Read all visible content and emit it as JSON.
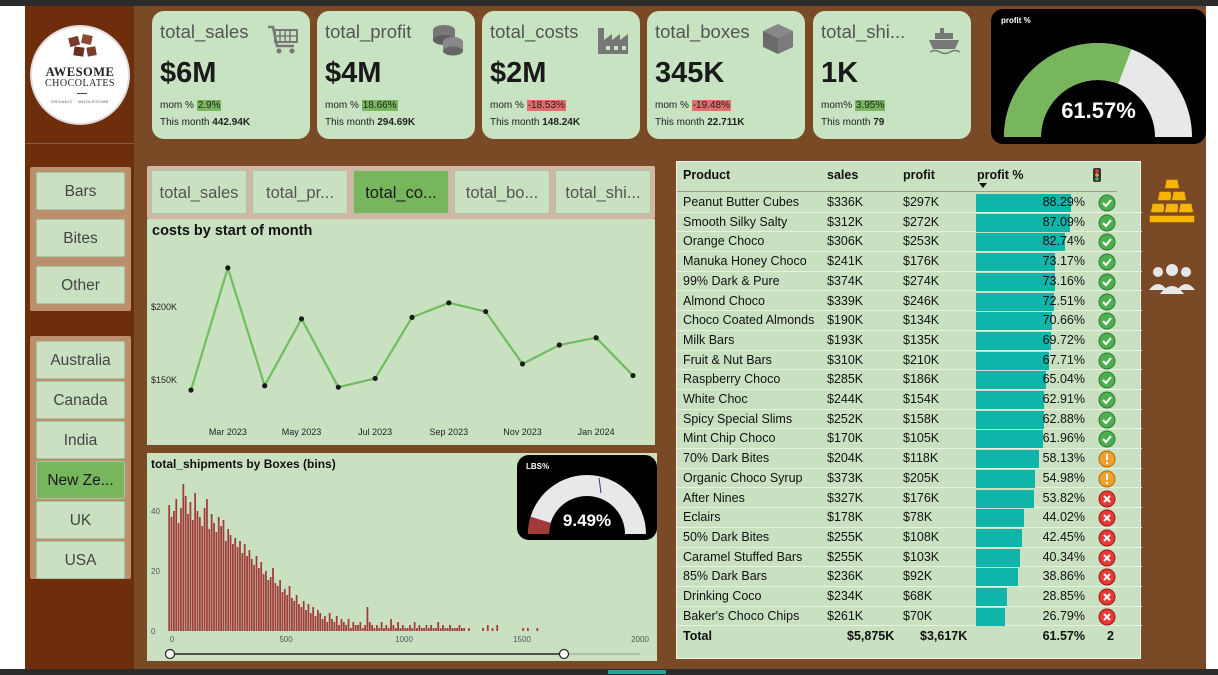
{
  "brand": {
    "line1": "AWESOME",
    "line2": "CHOCOLATES",
    "tagline": "ORGANIC · WHOLESOME"
  },
  "category_slicer": [
    "Bars",
    "Bites",
    "Other"
  ],
  "country_slicer": {
    "items": [
      "Australia",
      "Canada",
      "India",
      "New Ze...",
      "UK",
      "USA"
    ],
    "selected": "New Ze..."
  },
  "kpis": [
    {
      "title": "total_sales",
      "value": "$6M",
      "mom_label": "mom %",
      "mom_value": "2.9%",
      "mom_dir": "pos",
      "month_label": "This month",
      "month_value": "442.94K",
      "icon": "shopping-cart-icon"
    },
    {
      "title": "total_profit",
      "value": "$4M",
      "mom_label": "mom %",
      "mom_value": "18.66%",
      "mom_dir": "pos",
      "month_label": "This month",
      "month_value": "294.69K",
      "icon": "coins-icon"
    },
    {
      "title": "total_costs",
      "value": "$2M",
      "mom_label": "mom %",
      "mom_value": "-18.53%",
      "mom_dir": "neg",
      "month_label": "This month",
      "month_value": "148.24K",
      "icon": "factory-icon"
    },
    {
      "title": "total_boxes",
      "value": "345K",
      "mom_label": "mom %",
      "mom_value": "-19.48%",
      "mom_dir": "neg",
      "month_label": "This month",
      "month_value": "22.711K",
      "icon": "box-icon"
    },
    {
      "title": "total_shi...",
      "value": "1K",
      "mom_label": "mom%",
      "mom_value": "3.95%",
      "mom_dir": "pos",
      "month_label": "This month",
      "month_value": "79",
      "icon": "ship-icon"
    }
  ],
  "profit_gauge": {
    "label": "profit %",
    "value_text": "61.57%",
    "value": 61.57,
    "colors": {
      "fill": "#78b65e",
      "rest": "#e8e8e8"
    }
  },
  "metric_tabs": {
    "items": [
      "total_sales",
      "total_pr...",
      "total_co...",
      "total_bo...",
      "total_shi..."
    ],
    "selected": "total_co..."
  },
  "chart_data": [
    {
      "type": "line",
      "title": "costs by start of month",
      "x": [
        "Feb 2023",
        "Mar 2023",
        "Apr 2023",
        "May 2023",
        "Jun 2023",
        "Jul 2023",
        "Aug 2023",
        "Sep 2023",
        "Oct 2023",
        "Nov 2023",
        "Dec 2023",
        "Jan 2024",
        "Feb 2024"
      ],
      "x_tick_labels": [
        "Mar 2023",
        "May 2023",
        "Jul 2023",
        "Sep 2023",
        "Nov 2023",
        "Jan 2024"
      ],
      "y": [
        143,
        227,
        146,
        192,
        145,
        151,
        193,
        203,
        197,
        161,
        174,
        179,
        153
      ],
      "y_tick_labels": [
        "$200K",
        "$150K"
      ],
      "ylabel": "",
      "xlabel": "",
      "ylim": [
        130,
        240
      ],
      "y_unit": "$K",
      "color": "#6fbd5e",
      "grid": false
    },
    {
      "type": "bar",
      "title": "total_shipments by Boxes (bins)",
      "x_tick_labels": [
        "0",
        "500",
        "1000",
        "1500",
        "2000"
      ],
      "y_tick_labels": [
        "0",
        "20",
        "40"
      ],
      "xlim": [
        0,
        2000
      ],
      "ylim": [
        0,
        50
      ],
      "bin_width": 10,
      "bin_starts": [
        0,
        10,
        20,
        30,
        40,
        50,
        60,
        70,
        80,
        90,
        100,
        110,
        120,
        130,
        140,
        150,
        160,
        170,
        180,
        190,
        200,
        210,
        220,
        230,
        240,
        250,
        260,
        270,
        280,
        290,
        300,
        310,
        320,
        330,
        340,
        350,
        360,
        370,
        380,
        390,
        400,
        410,
        420,
        430,
        440,
        450,
        460,
        470,
        480,
        490,
        500,
        510,
        520,
        530,
        540,
        550,
        560,
        570,
        580,
        590,
        600,
        610,
        620,
        630,
        640,
        650,
        660,
        670,
        680,
        690,
        700,
        710,
        720,
        730,
        740,
        750,
        760,
        770,
        780,
        790,
        800,
        810,
        820,
        830,
        840,
        850,
        860,
        870,
        880,
        890,
        900,
        910,
        920,
        930,
        940,
        950,
        960,
        970,
        980,
        990,
        1000,
        1010,
        1020,
        1030,
        1040,
        1050,
        1060,
        1070,
        1080,
        1090,
        1100,
        1110,
        1120,
        1130,
        1140,
        1150,
        1160,
        1170,
        1180,
        1190,
        1200,
        1210,
        1220,
        1230,
        1240,
        1250,
        1270,
        1330,
        1350,
        1370,
        1390,
        1500,
        1520,
        1560
      ],
      "values": [
        42,
        38,
        40,
        44,
        36,
        41,
        49,
        45,
        39,
        43,
        37,
        46,
        40,
        38,
        35,
        41,
        44,
        34,
        39,
        36,
        33,
        38,
        35,
        37,
        30,
        34,
        32,
        29,
        31,
        28,
        30,
        26,
        29,
        25,
        27,
        24,
        22,
        25,
        21,
        23,
        19,
        20,
        17,
        18,
        21,
        16,
        15,
        17,
        13,
        14,
        12,
        15,
        11,
        10,
        12,
        9,
        8,
        10,
        7,
        9,
        6,
        8,
        5,
        7,
        6,
        4,
        5,
        3,
        6,
        4,
        3,
        5,
        2,
        4,
        3,
        2,
        4,
        1,
        3,
        2,
        2,
        3,
        1,
        2,
        8,
        3,
        2,
        1,
        2,
        1,
        3,
        1,
        2,
        1,
        4,
        2,
        1,
        3,
        1,
        2,
        1,
        1,
        2,
        1,
        3,
        1,
        2,
        1,
        1,
        2,
        1,
        2,
        1,
        1,
        3,
        1,
        2,
        1,
        1,
        2,
        1,
        1,
        1,
        2,
        1,
        1,
        1,
        1,
        2,
        1,
        2,
        1,
        1,
        1
      ],
      "color": "#a23a3a"
    }
  ],
  "lbs_gauge": {
    "label": "LBS%",
    "value_text": "9.49%",
    "value": 9.49,
    "colors": {
      "fill": "#a23a3a",
      "rest": "#e8e8e8"
    }
  },
  "product_table": {
    "headers": {
      "product": "Product",
      "sales": "sales",
      "profit": "profit",
      "profit_pct": "profit %"
    },
    "rows": [
      {
        "product": "Peanut Butter Cubes",
        "sales": "$336K",
        "profit": "$297K",
        "profit_pct": "88.29%",
        "pct": 88.29,
        "status": "ok"
      },
      {
        "product": "Smooth Silky Salty",
        "sales": "$312K",
        "profit": "$272K",
        "profit_pct": "87.09%",
        "pct": 87.09,
        "status": "ok"
      },
      {
        "product": "Orange Choco",
        "sales": "$306K",
        "profit": "$253K",
        "profit_pct": "82.74%",
        "pct": 82.74,
        "status": "ok"
      },
      {
        "product": "Manuka Honey Choco",
        "sales": "$241K",
        "profit": "$176K",
        "profit_pct": "73.17%",
        "pct": 73.17,
        "status": "ok"
      },
      {
        "product": "99% Dark & Pure",
        "sales": "$374K",
        "profit": "$274K",
        "profit_pct": "73.16%",
        "pct": 73.16,
        "status": "ok"
      },
      {
        "product": "Almond Choco",
        "sales": "$339K",
        "profit": "$246K",
        "profit_pct": "72.51%",
        "pct": 72.51,
        "status": "ok"
      },
      {
        "product": "Choco Coated Almonds",
        "sales": "$190K",
        "profit": "$134K",
        "profit_pct": "70.66%",
        "pct": 70.66,
        "status": "ok"
      },
      {
        "product": "Milk Bars",
        "sales": "$193K",
        "profit": "$135K",
        "profit_pct": "69.72%",
        "pct": 69.72,
        "status": "ok"
      },
      {
        "product": "Fruit & Nut Bars",
        "sales": "$310K",
        "profit": "$210K",
        "profit_pct": "67.71%",
        "pct": 67.71,
        "status": "ok"
      },
      {
        "product": "Raspberry Choco",
        "sales": "$285K",
        "profit": "$186K",
        "profit_pct": "65.04%",
        "pct": 65.04,
        "status": "ok"
      },
      {
        "product": "White Choc",
        "sales": "$244K",
        "profit": "$154K",
        "profit_pct": "62.91%",
        "pct": 62.91,
        "status": "ok"
      },
      {
        "product": "Spicy Special Slims",
        "sales": "$252K",
        "profit": "$158K",
        "profit_pct": "62.88%",
        "pct": 62.88,
        "status": "ok"
      },
      {
        "product": "Mint Chip Choco",
        "sales": "$170K",
        "profit": "$105K",
        "profit_pct": "61.96%",
        "pct": 61.96,
        "status": "ok"
      },
      {
        "product": "70% Dark Bites",
        "sales": "$204K",
        "profit": "$118K",
        "profit_pct": "58.13%",
        "pct": 58.13,
        "status": "warn"
      },
      {
        "product": "Organic Choco Syrup",
        "sales": "$373K",
        "profit": "$205K",
        "profit_pct": "54.98%",
        "pct": 54.98,
        "status": "warn"
      },
      {
        "product": "After Nines",
        "sales": "$327K",
        "profit": "$176K",
        "profit_pct": "53.82%",
        "pct": 53.82,
        "status": "bad"
      },
      {
        "product": "Eclairs",
        "sales": "$178K",
        "profit": "$78K",
        "profit_pct": "44.02%",
        "pct": 44.02,
        "status": "bad"
      },
      {
        "product": "50% Dark Bites",
        "sales": "$255K",
        "profit": "$108K",
        "profit_pct": "42.45%",
        "pct": 42.45,
        "status": "bad"
      },
      {
        "product": "Caramel Stuffed Bars",
        "sales": "$255K",
        "profit": "$103K",
        "profit_pct": "40.34%",
        "pct": 40.34,
        "status": "bad"
      },
      {
        "product": "85% Dark Bars",
        "sales": "$236K",
        "profit": "$92K",
        "profit_pct": "38.86%",
        "pct": 38.86,
        "status": "bad"
      },
      {
        "product": "Drinking Coco",
        "sales": "$234K",
        "profit": "$68K",
        "profit_pct": "28.85%",
        "pct": 28.85,
        "status": "bad"
      },
      {
        "product": "Baker's Choco Chips",
        "sales": "$261K",
        "profit": "$70K",
        "profit_pct": "26.79%",
        "pct": 26.79,
        "status": "bad"
      }
    ],
    "total": {
      "label": "Total",
      "sales": "$5,875K",
      "profit": "$3,617K",
      "profit_pct": "61.57%",
      "status_count": "2"
    }
  },
  "side_icons": [
    "gold-bars-icon",
    "people-icon"
  ],
  "colors": {
    "accent_green": "#78b65e",
    "panel": "#c9e1c1",
    "bar_teal": "#0fb5a8",
    "hist_red": "#a23a3a",
    "status_ok": "#4caf50",
    "status_warn": "#f0a030",
    "status_bad": "#e53935"
  }
}
